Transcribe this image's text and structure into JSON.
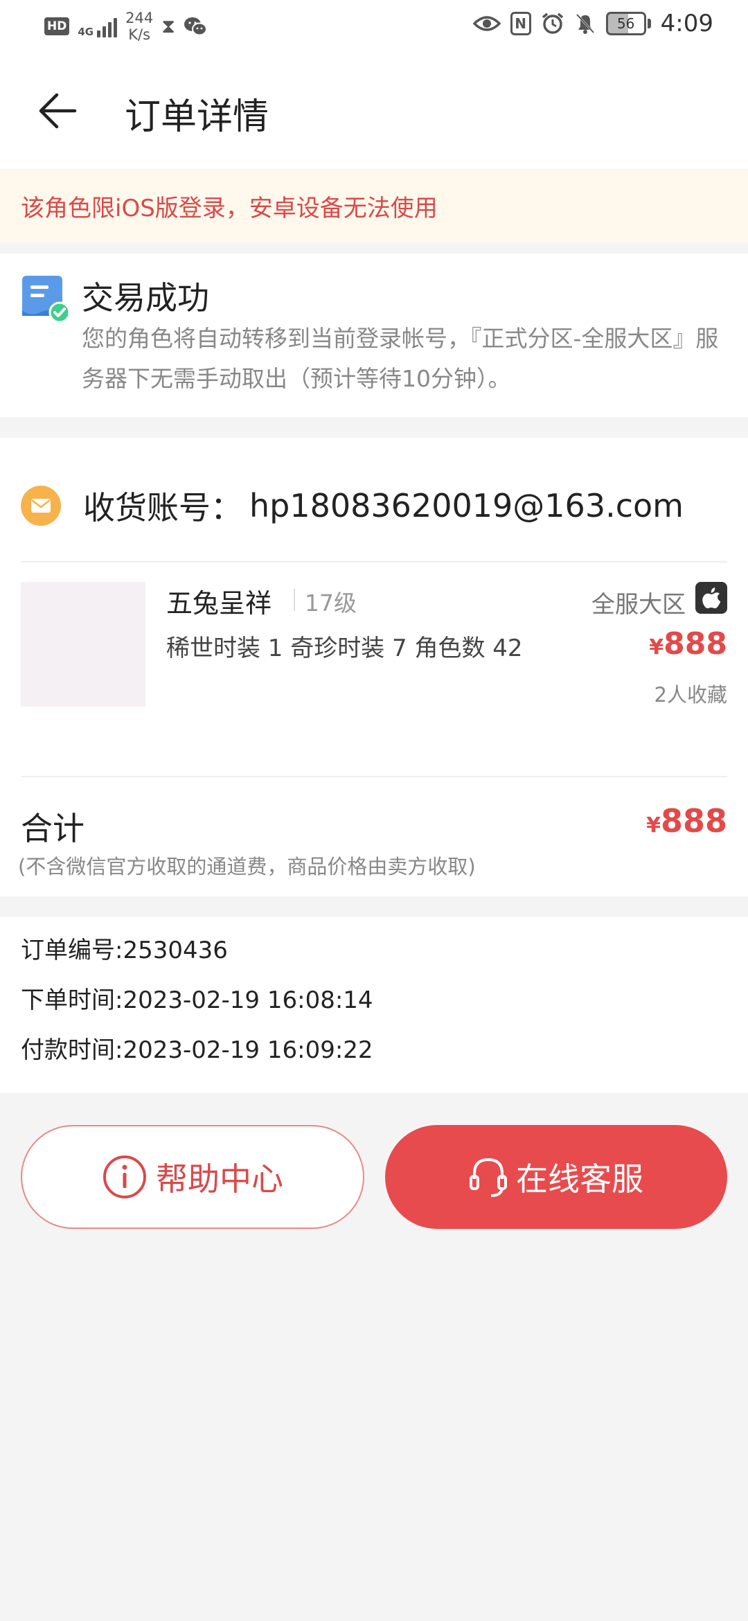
{
  "status_bar": {
    "hd": "HD",
    "network": "4G",
    "speed_value": "244",
    "speed_unit": "K/s",
    "nfc": "N",
    "battery": "56",
    "time": "4:09"
  },
  "app_bar": {
    "title": "订单详情"
  },
  "notice": {
    "text": "该角色限iOS版登录，安卓设备无法使用"
  },
  "status_card": {
    "title": "交易成功",
    "description": "您的角色将自动转移到当前登录帐号，『正式分区-全服大区』服务器下无需手动取出（预计等待10分钟）。"
  },
  "order": {
    "account_label": "收货账号：",
    "account_value": "hp18083620019@163.com",
    "product": {
      "name": "五兔呈祥",
      "level": "17级",
      "attributes": "稀世时装 1 奇珍时装 7 角色数 42",
      "server": "全服大区",
      "currency": "¥",
      "price": "888",
      "favorites": "2人收藏"
    },
    "total_label": "合计",
    "total_currency": "¥",
    "total_price": "888",
    "total_note": "(不含微信官方收取的通道费，商品价格由卖方收取)"
  },
  "info": {
    "order_no": "订单编号:2530436",
    "order_time": "下单时间:2023-02-19 16:08:14",
    "pay_time": "付款时间:2023-02-19 16:09:22"
  },
  "actions": {
    "help_label": "帮助中心",
    "service_label": "在线客服"
  },
  "colors": {
    "accent": "#e84b4d",
    "notice_bg": "#fff8ec",
    "notice_text": "#d84a4a",
    "mail_icon": "#f7b24c",
    "success_icon": "#4a90e2"
  }
}
